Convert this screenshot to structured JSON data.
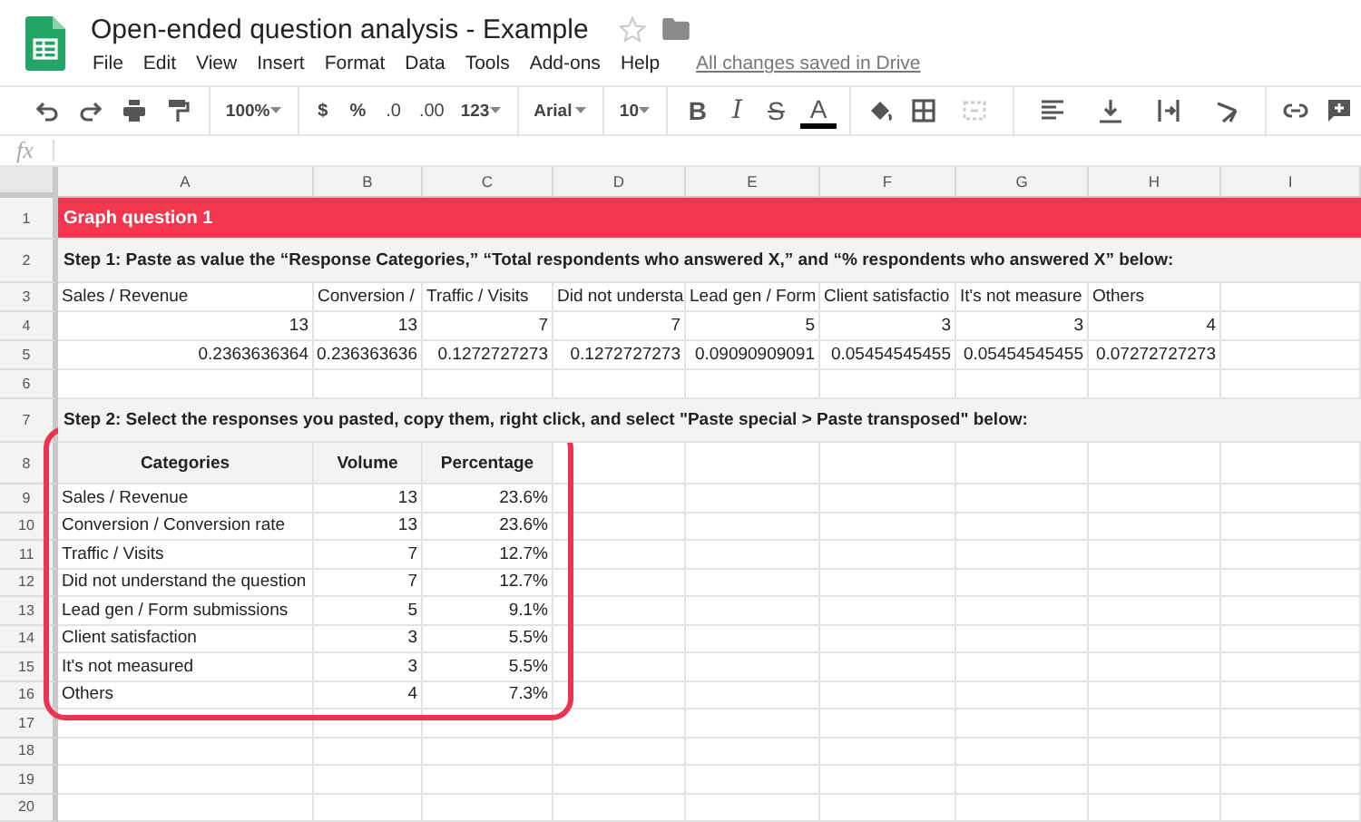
{
  "app": {
    "title": "Open-ended question analysis - Example",
    "starred": false,
    "menu": [
      "File",
      "Edit",
      "View",
      "Insert",
      "Format",
      "Data",
      "Tools",
      "Add-ons",
      "Help"
    ],
    "save_status": "All changes saved in Drive"
  },
  "toolbar": {
    "zoom": "100%",
    "currency": "$",
    "percent": "%",
    "decrease_decimals": ".0",
    "increase_decimals": ".00",
    "more_formats": "123",
    "font": "Arial",
    "font_size": "10",
    "bold": "B",
    "italic": "I",
    "strikethrough": "S",
    "text_color": "A"
  },
  "formula_bar": {
    "label": "fx"
  },
  "columns": [
    "A",
    "B",
    "C",
    "D",
    "E",
    "F",
    "G",
    "H",
    "I"
  ],
  "rows": [
    {
      "number": "1",
      "kind": "title",
      "text": "Graph question 1"
    },
    {
      "number": "2",
      "kind": "note",
      "text": "Step 1: Paste as value the “Response Categories,” “Total respondents who answered X,” and “% respondents who answered X” below:"
    },
    {
      "number": "3",
      "kind": "cells",
      "cells": [
        {
          "text": "Sales / Revenue",
          "kind": "text"
        },
        {
          "text": "Conversion /",
          "kind": "text"
        },
        {
          "text": "Traffic / Visits",
          "kind": "text"
        },
        {
          "text": "Did not understa",
          "kind": "text"
        },
        {
          "text": "Lead gen / Form",
          "kind": "text"
        },
        {
          "text": "Client satisfactio",
          "kind": "text"
        },
        {
          "text": "It's not measure",
          "kind": "text"
        },
        {
          "text": "Others",
          "kind": "text"
        }
      ]
    },
    {
      "number": "4",
      "kind": "cells",
      "cells": [
        {
          "text": "13",
          "kind": "number"
        },
        {
          "text": "13",
          "kind": "number"
        },
        {
          "text": "7",
          "kind": "number"
        },
        {
          "text": "7",
          "kind": "number"
        },
        {
          "text": "5",
          "kind": "number"
        },
        {
          "text": "3",
          "kind": "number"
        },
        {
          "text": "3",
          "kind": "number"
        },
        {
          "text": "4",
          "kind": "number"
        }
      ]
    },
    {
      "number": "5",
      "kind": "cells",
      "cells": [
        {
          "text": "0.2363636364",
          "kind": "number"
        },
        {
          "text": "0.236363636",
          "kind": "number"
        },
        {
          "text": "0.1272727273",
          "kind": "number"
        },
        {
          "text": "0.1272727273",
          "kind": "number"
        },
        {
          "text": "0.09090909091",
          "kind": "number"
        },
        {
          "text": "0.05454545455",
          "kind": "number"
        },
        {
          "text": "0.05454545455",
          "kind": "number"
        },
        {
          "text": "0.07272727273",
          "kind": "number"
        }
      ]
    },
    {
      "number": "6",
      "kind": "cells"
    },
    {
      "number": "7",
      "kind": "note",
      "text": "Step 2: Select the responses you pasted, copy them, right click, and select \"Paste special > Paste transposed\" below:"
    },
    {
      "number": "8",
      "kind": "cells",
      "cells": [
        {
          "text": "Categories",
          "kind": "header"
        },
        {
          "text": "Volume",
          "kind": "header"
        },
        {
          "text": "Percentage",
          "kind": "header"
        }
      ]
    },
    {
      "number": "9",
      "kind": "cells",
      "cells": [
        {
          "text": "Sales / Revenue",
          "kind": "text"
        },
        {
          "text": "13",
          "kind": "number"
        },
        {
          "text": "23.6%",
          "kind": "number"
        }
      ]
    },
    {
      "number": "10",
      "kind": "cells",
      "cells": [
        {
          "text": "Conversion / Conversion rate",
          "kind": "text"
        },
        {
          "text": "13",
          "kind": "number"
        },
        {
          "text": "23.6%",
          "kind": "number"
        }
      ]
    },
    {
      "number": "11",
      "kind": "cells",
      "cells": [
        {
          "text": "Traffic / Visits",
          "kind": "text"
        },
        {
          "text": "7",
          "kind": "number"
        },
        {
          "text": "12.7%",
          "kind": "number"
        }
      ]
    },
    {
      "number": "12",
      "kind": "cells",
      "cells": [
        {
          "text": "Did not understand the question",
          "kind": "text"
        },
        {
          "text": "7",
          "kind": "number"
        },
        {
          "text": "12.7%",
          "kind": "number"
        }
      ]
    },
    {
      "number": "13",
      "kind": "cells",
      "cells": [
        {
          "text": "Lead gen / Form submissions",
          "kind": "text"
        },
        {
          "text": "5",
          "kind": "number"
        },
        {
          "text": "9.1%",
          "kind": "number"
        }
      ]
    },
    {
      "number": "14",
      "kind": "cells",
      "cells": [
        {
          "text": "Client satisfaction",
          "kind": "text"
        },
        {
          "text": "3",
          "kind": "number"
        },
        {
          "text": "5.5%",
          "kind": "number"
        }
      ]
    },
    {
      "number": "15",
      "kind": "cells",
      "cells": [
        {
          "text": "It's not measured",
          "kind": "text"
        },
        {
          "text": "3",
          "kind": "number"
        },
        {
          "text": "5.5%",
          "kind": "number"
        }
      ]
    },
    {
      "number": "16",
      "kind": "cells",
      "cells": [
        {
          "text": "Others",
          "kind": "text"
        },
        {
          "text": "4",
          "kind": "number"
        },
        {
          "text": "7.3%",
          "kind": "number"
        }
      ]
    },
    {
      "number": "17",
      "kind": "cells"
    },
    {
      "number": "18",
      "kind": "cells"
    },
    {
      "number": "19",
      "kind": "cells"
    },
    {
      "number": "20",
      "kind": "cells"
    }
  ]
}
